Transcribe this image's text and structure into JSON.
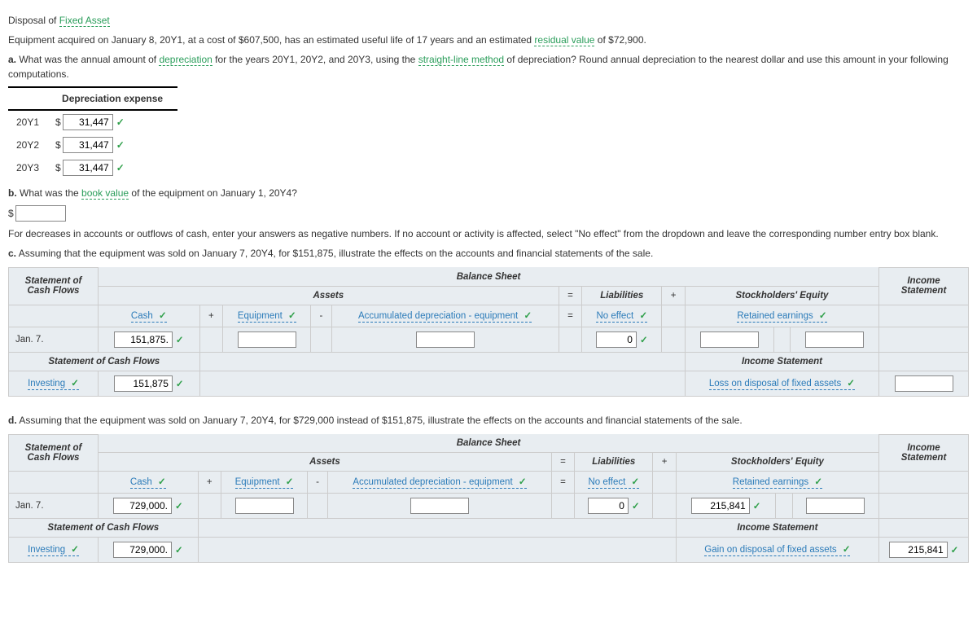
{
  "title": {
    "prefix": "Disposal of ",
    "link": "Fixed Asset"
  },
  "intro": {
    "t1": "Equipment acquired on January 8, 20Y1, at a cost of $607,500, has an estimated useful life of 17 years and an estimated ",
    "link1": "residual value",
    "t2": " of $72,900."
  },
  "qa": {
    "label": "a.",
    "t1": "  What was the annual amount of ",
    "link1": "depreciation",
    "t2": " for the years 20Y1, 20Y2, and 20Y3, using the ",
    "link2": "straight-line method",
    "t3": " of depreciation? Round annual depreciation to the nearest dollar and use this amount in your following computations."
  },
  "dep": {
    "header": "Depreciation expense",
    "rows": [
      {
        "year": "20Y1",
        "dollar": "$",
        "val": "31,447"
      },
      {
        "year": "20Y2",
        "dollar": "$",
        "val": "31,447"
      },
      {
        "year": "20Y3",
        "dollar": "$",
        "val": "31,447"
      }
    ]
  },
  "qb": {
    "label": "b.",
    "t1": "  What was the ",
    "link1": "book value",
    "t2": " of the equipment on January 1, 20Y4?",
    "dollar": "$",
    "val": ""
  },
  "note": "For decreases in accounts or outflows of cash, enter your answers as negative numbers. If no account or activity is affected, select \"No effect\" from the dropdown and leave the corresponding number entry box blank.",
  "qc": {
    "label": "c.",
    "text": "  Assuming that the equipment was sold on January 7, 20Y4, for $151,875, illustrate the effects on the accounts and financial statements of the sale."
  },
  "qd": {
    "label": "d.",
    "text": "  Assuming that the equipment was sold on January 7, 20Y4, for $729,000 instead of $151,875, illustrate the effects on the accounts and financial statements of the sale."
  },
  "tbl": {
    "balance_sheet": "Balance Sheet",
    "stmt_cf": "Statement of Cash Flows",
    "income_stmt_col": "Income Statement",
    "assets": "Assets",
    "eq": "=",
    "liabilities": "Liabilities",
    "plus": "+",
    "minus": "-",
    "stockholders": "Stockholders' Equity",
    "cash": "Cash",
    "equipment": "Equipment",
    "accum_dep": "Accumulated depreciation - equipment",
    "no_effect": "No effect",
    "retained": "Retained earnings",
    "jan7": "Jan. 7.",
    "scf_hdr": "Statement of Cash Flows",
    "is_hdr": "Income Statement",
    "investing": "Investing",
    "loss": "Loss on disposal of fixed assets",
    "gain": "Gain on disposal of fixed assets"
  },
  "c_vals": {
    "cash": "151,875.",
    "equip": "",
    "accum": "",
    "liab": "0",
    "re1": "",
    "re2": "",
    "scf": "151,875",
    "is": ""
  },
  "d_vals": {
    "cash": "729,000.",
    "equip": "",
    "accum": "",
    "liab": "0",
    "re1": "215,841",
    "re2": "",
    "scf": "729,000.",
    "is": "215,841"
  }
}
